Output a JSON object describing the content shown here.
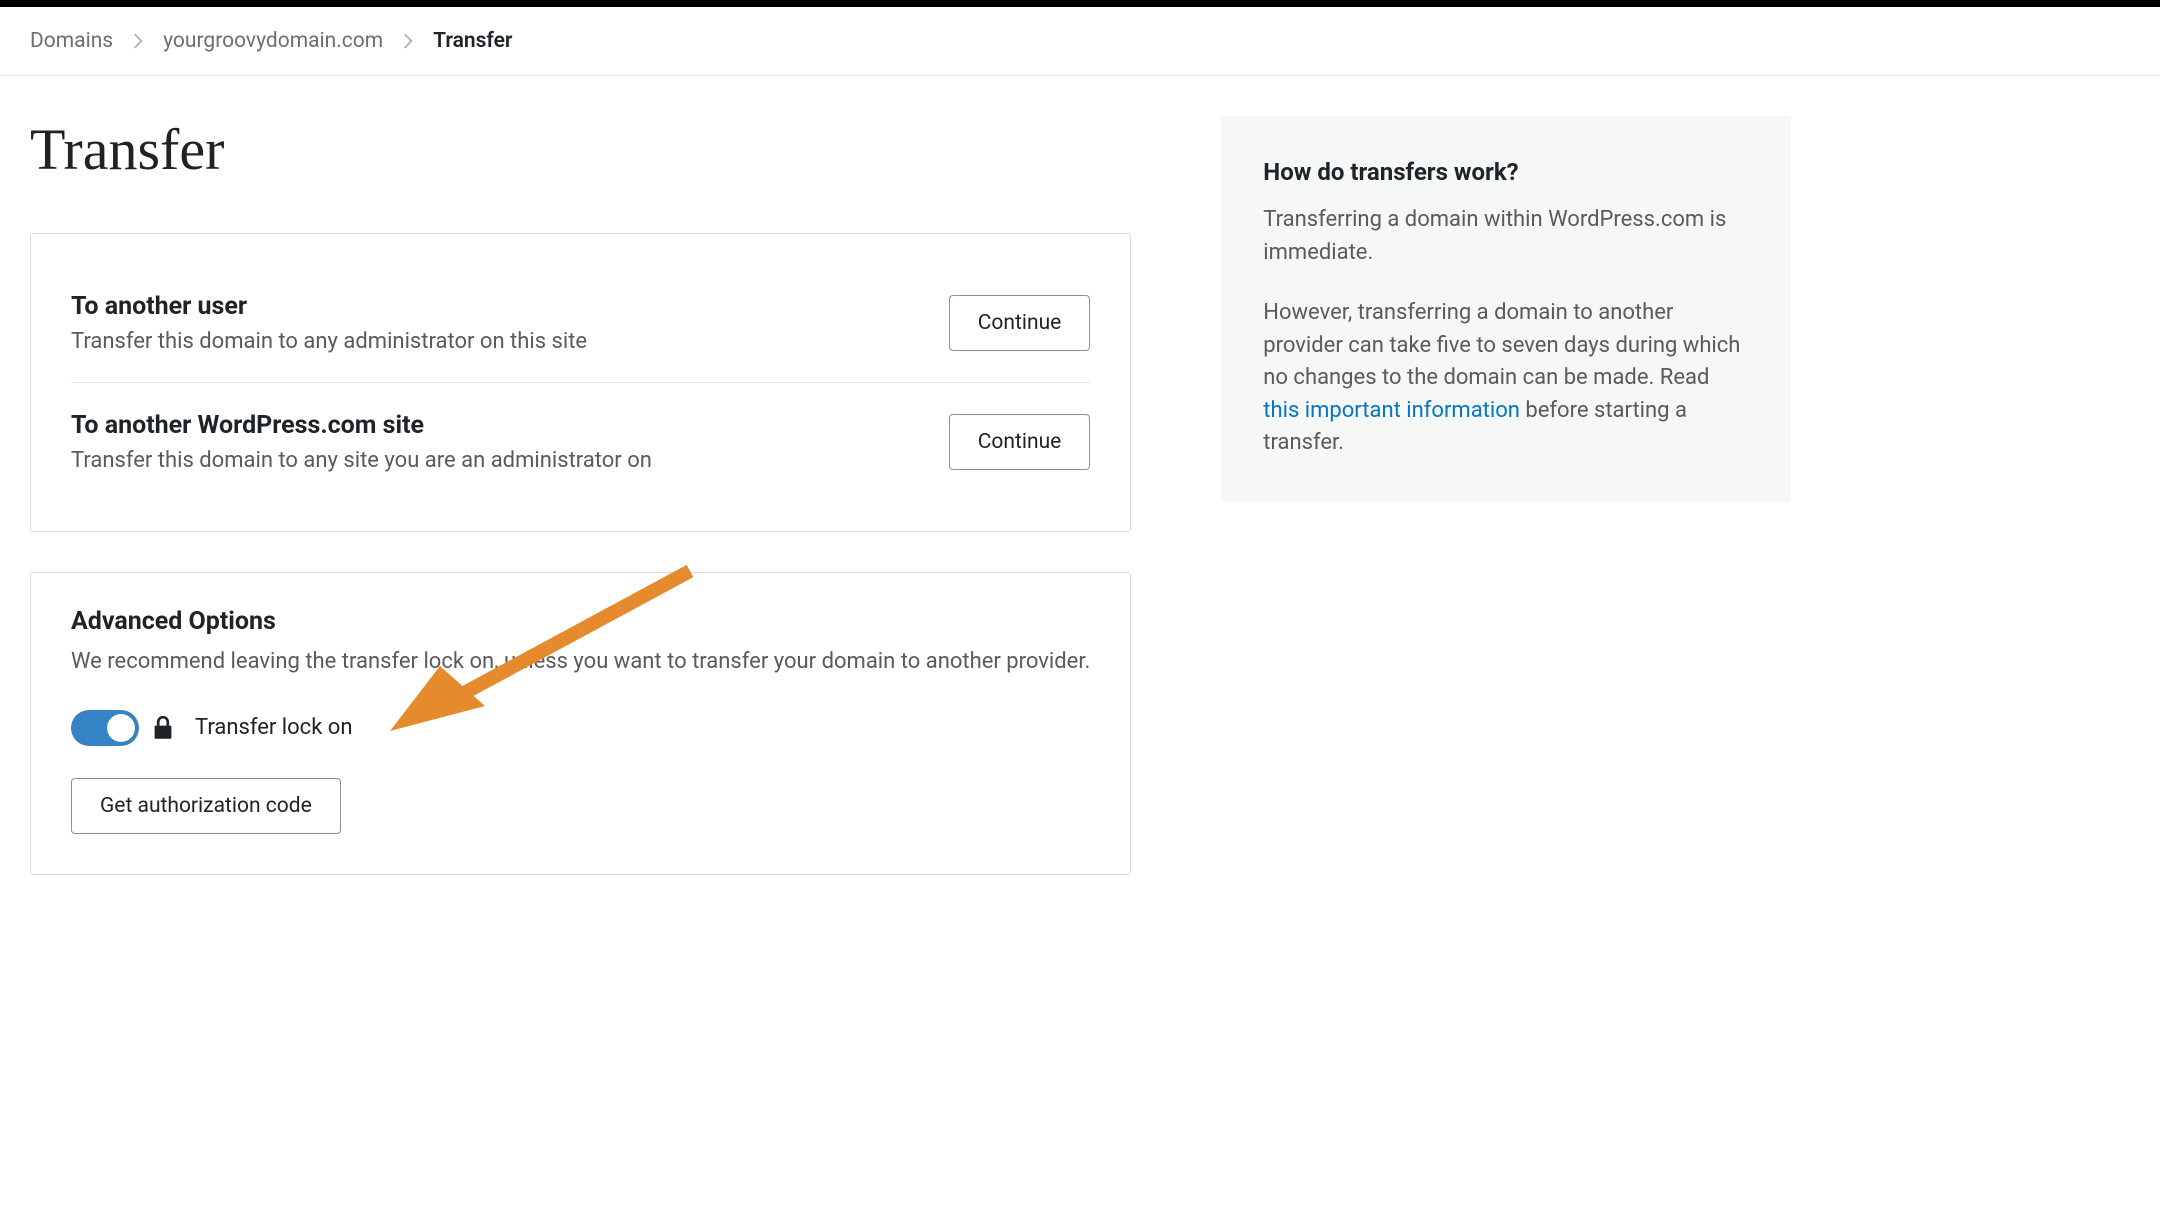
{
  "breadcrumb": {
    "items": [
      {
        "label": "Domains"
      },
      {
        "label": "yourgroovydomain.com"
      }
    ],
    "current": "Transfer"
  },
  "page_title": "Transfer",
  "transfer_options": [
    {
      "title": "To another user",
      "desc": "Transfer this domain to any administrator on this site",
      "button": "Continue"
    },
    {
      "title": "To another WordPress.com site",
      "desc": "Transfer this domain to any site you are an administrator on",
      "button": "Continue"
    }
  ],
  "advanced": {
    "title": "Advanced Options",
    "desc": "We recommend leaving the transfer lock on, unless you want to transfer your domain to another provider.",
    "toggle_label": "Transfer lock on",
    "auth_button": "Get authorization code"
  },
  "info": {
    "title": "How do transfers work?",
    "p1": "Transferring a domain within WordPress.com is immediate.",
    "p2_a": "However, transferring a domain to another provider can take five to seven days during which no changes to the domain can be made. Read ",
    "p2_link": "this important information",
    "p2_b": " before starting a transfer."
  }
}
